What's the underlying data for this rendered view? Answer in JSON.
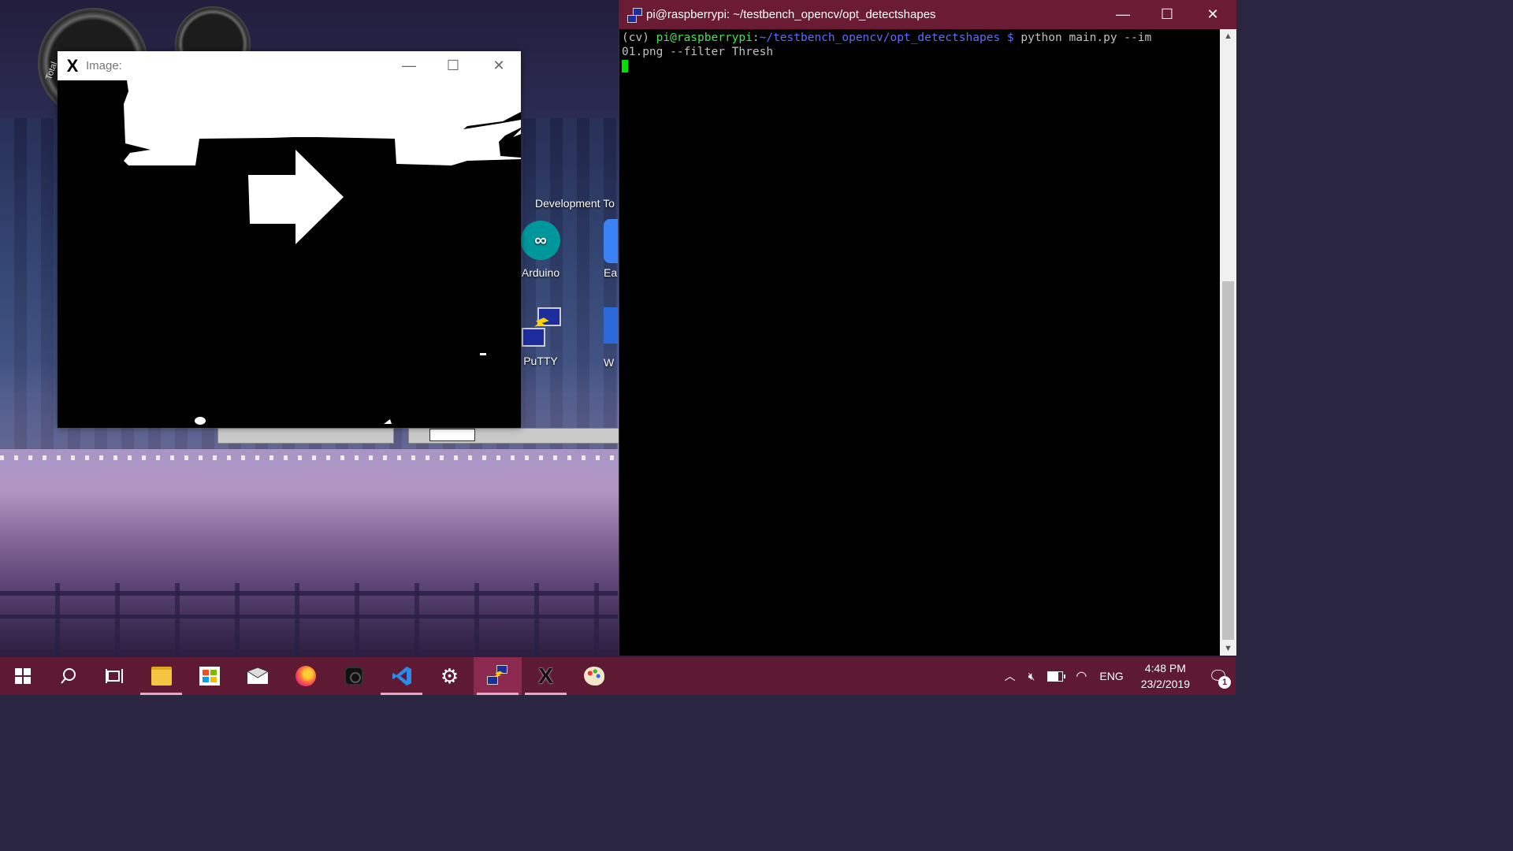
{
  "desktop": {
    "gauge_label": "Total",
    "group_label": "Development To",
    "icons": [
      {
        "label": "Arduino",
        "icon": "arduino-icon"
      },
      {
        "label": "Ea",
        "icon": "app-icon"
      },
      {
        "label": "PuTTY",
        "icon": "putty-icon"
      },
      {
        "label": "W",
        "icon": "app-icon"
      }
    ]
  },
  "image_window": {
    "title": "Image:",
    "minimize": "—",
    "maximize": "☐",
    "close": "✕"
  },
  "terminal": {
    "title": "pi@raspberrypi: ~/testbench_opencv/opt_detectshapes",
    "prompt_env": "(cv) ",
    "prompt_user": "pi@raspberrypi",
    "prompt_sep": ":",
    "prompt_path": "~/testbench_opencv/opt_detectshapes $",
    "command_line1": " python main.py --im",
    "command_line2": "01.png --filter Thresh",
    "minimize": "—",
    "maximize": "☐",
    "close": "✕",
    "colors": {
      "title_bg": "#6b1b34",
      "user": "#4be04b",
      "path": "#5c6cff",
      "cursor": "#00e000"
    }
  },
  "taskbar": {
    "buttons": [
      {
        "name": "start-button",
        "icon": "windows-icon"
      },
      {
        "name": "search-button",
        "icon": "search-icon"
      },
      {
        "name": "task-view-button",
        "icon": "task-view-icon"
      },
      {
        "name": "file-explorer-button",
        "icon": "folder-icon"
      },
      {
        "name": "store-button",
        "icon": "store-icon"
      },
      {
        "name": "mail-button",
        "icon": "mail-icon"
      },
      {
        "name": "firefox-button",
        "icon": "firefox-icon"
      },
      {
        "name": "camera-app-button",
        "icon": "camera-icon"
      },
      {
        "name": "vscode-button",
        "icon": "vscode-icon"
      },
      {
        "name": "settings-button",
        "icon": "gear-icon"
      },
      {
        "name": "putty-button",
        "icon": "putty-icon"
      },
      {
        "name": "xming-button",
        "icon": "x-icon"
      },
      {
        "name": "paint-button",
        "icon": "palette-icon"
      }
    ],
    "tray": {
      "language": "ENG",
      "time": "4:48 PM",
      "date": "23/2/2019",
      "notification_count": "1"
    },
    "colors": {
      "bg": "#5e1a33",
      "active_underline": "#e6a8bf"
    }
  }
}
